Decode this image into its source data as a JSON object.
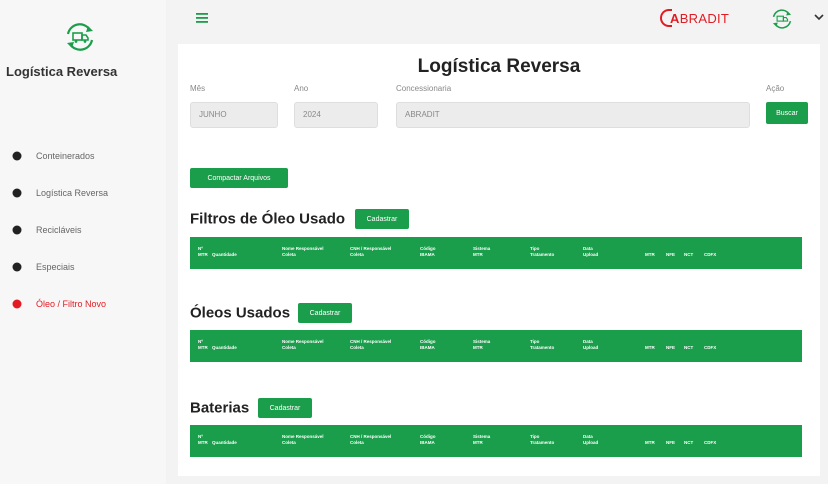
{
  "sidebar": {
    "title": "Logística Reversa",
    "items": [
      {
        "label": "Conteinerados",
        "active": false
      },
      {
        "label": "Logística Reversa",
        "active": false
      },
      {
        "label": "Recicláveis",
        "active": false
      },
      {
        "label": "Especiais",
        "active": false
      },
      {
        "label": "Óleo / Filtro Novo",
        "active": true
      }
    ]
  },
  "topbar": {
    "brand_letter": "A",
    "brand": "BRADIT"
  },
  "main": {
    "title": "Logística Reversa",
    "filters": {
      "mes_label": "Mês",
      "mes_value": "JUNHO",
      "ano_label": "Ano",
      "ano_value": "2024",
      "conc_label": "Concessionaria",
      "conc_value": "ABRADIT",
      "acao_label": "Ação",
      "buscar_label": "Buscar"
    },
    "compactar_label": "Compactar Arquivos",
    "table_headers": [
      [
        "Nº",
        "MTR"
      ],
      [
        "Quantidade"
      ],
      [
        "Nome Responsável",
        "Coleta"
      ],
      [
        "CNH / Responsável",
        "Coleta"
      ],
      [
        "Código",
        "IBAMA"
      ],
      [
        "Sistema",
        "MTR"
      ],
      [
        "Tipo",
        "Tratamento"
      ],
      [
        "Data",
        "Upload"
      ],
      [
        "MTR"
      ],
      [
        "NFE"
      ],
      [
        "NCT"
      ],
      [
        "CDFX"
      ]
    ],
    "sections": [
      {
        "title": "Filtros de Óleo Usado",
        "button": "Cadastrar"
      },
      {
        "title": "Óleos Usados",
        "button": "Cadastrar"
      },
      {
        "title": "Baterias",
        "button": "Cadastrar"
      }
    ]
  },
  "colors": {
    "accent_green": "#1b9e4b",
    "brand_red": "#e21b23"
  }
}
